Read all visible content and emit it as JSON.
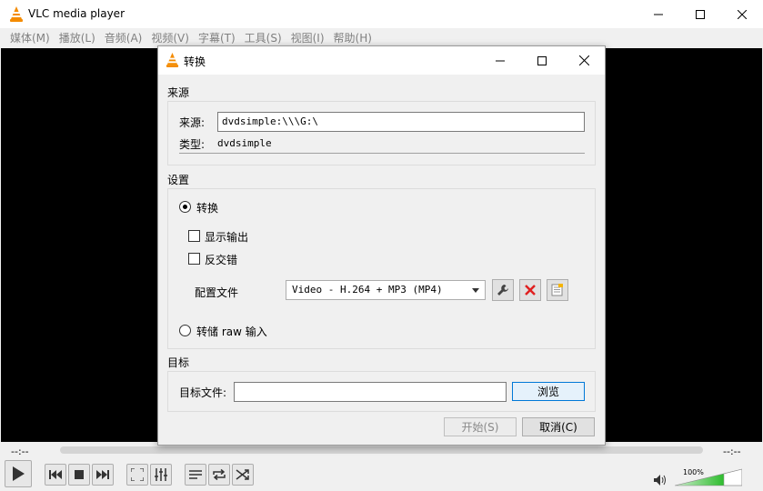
{
  "app": {
    "title": "VLC media player"
  },
  "menu": [
    "媒体(M)",
    "播放(L)",
    "音频(A)",
    "视频(V)",
    "字幕(T)",
    "工具(S)",
    "视图(I)",
    "帮助(H)"
  ],
  "controls": {
    "elapsed": "--:--",
    "remaining": "--:--",
    "volume_label": "100%",
    "volume_percent": 100
  },
  "dialog": {
    "title": "转换",
    "source": {
      "section": "来源",
      "source_label": "来源:",
      "source_value": "dvdsimple:\\\\\\G:\\",
      "type_label": "类型:",
      "type_value": "dvdsimple"
    },
    "settings": {
      "section": "设置",
      "convert_label": "转换",
      "convert_selected": true,
      "show_output_label": "显示输出",
      "show_output_checked": false,
      "deinterlace_label": "反交错",
      "deinterlace_checked": false,
      "profile_label": "配置文件",
      "profile_value": "Video - H.264 + MP3 (MP4)",
      "raw_label": "转储 raw 输入",
      "raw_selected": false
    },
    "destination": {
      "section": "目标",
      "file_label": "目标文件:",
      "file_value": "",
      "browse_label": "浏览"
    },
    "start_label": "开始(S)",
    "cancel_label": "取消(C)"
  }
}
